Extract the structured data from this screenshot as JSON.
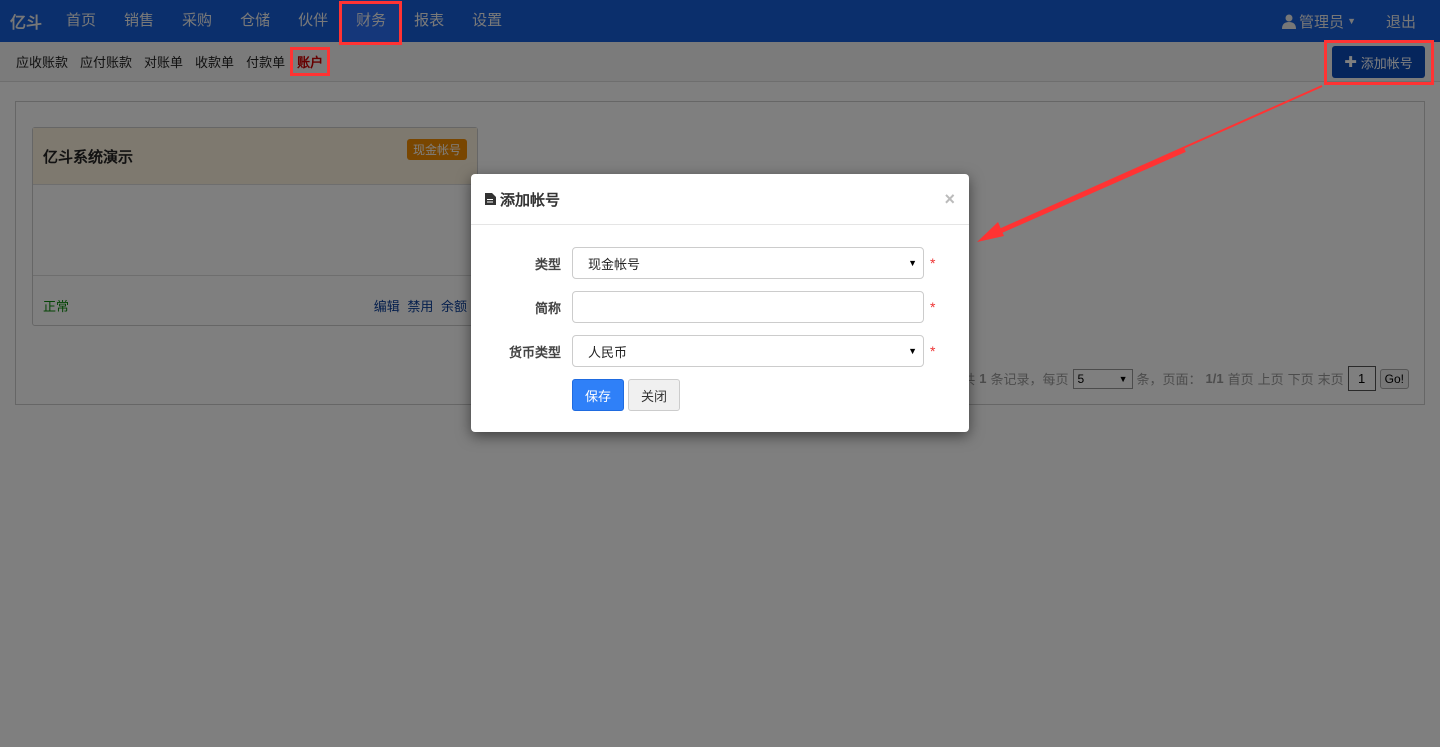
{
  "navbar": {
    "brand": "亿斗",
    "items": [
      "首页",
      "销售",
      "采购",
      "仓储",
      "伙伴",
      "财务",
      "报表",
      "设置"
    ],
    "active": "财务",
    "user": "管理员",
    "logout": "退出"
  },
  "subnav": {
    "items": [
      "应收账款",
      "应付账款",
      "对账单",
      "收款单",
      "付款单",
      "账户"
    ],
    "active": "账户"
  },
  "add_button": "添加帐号",
  "card": {
    "title": "亿斗系统演示",
    "badge": "现金帐号",
    "status": "正常",
    "actions": [
      "编辑",
      "禁用",
      "余额"
    ]
  },
  "pager": {
    "prefix": "共",
    "total": "1",
    "records": "条记录，每页",
    "per_page": "5",
    "suffix": "条，页面：",
    "page": "1/1",
    "first": "首页",
    "prev": "上页",
    "next": "下页",
    "last": "末页",
    "page_input": "1",
    "go": "Go!"
  },
  "modal": {
    "title": "添加帐号",
    "close": "×",
    "fields": [
      {
        "label": "类型",
        "value": "现金帐号"
      },
      {
        "label": "简称",
        "value": ""
      },
      {
        "label": "货币类型",
        "value": "人民币"
      }
    ],
    "required": "*",
    "save": "保存",
    "cancel": "关闭"
  },
  "colors": {
    "navbar": "#175ed8",
    "annotation": "#ff3333",
    "primary": "#2f80f8"
  }
}
